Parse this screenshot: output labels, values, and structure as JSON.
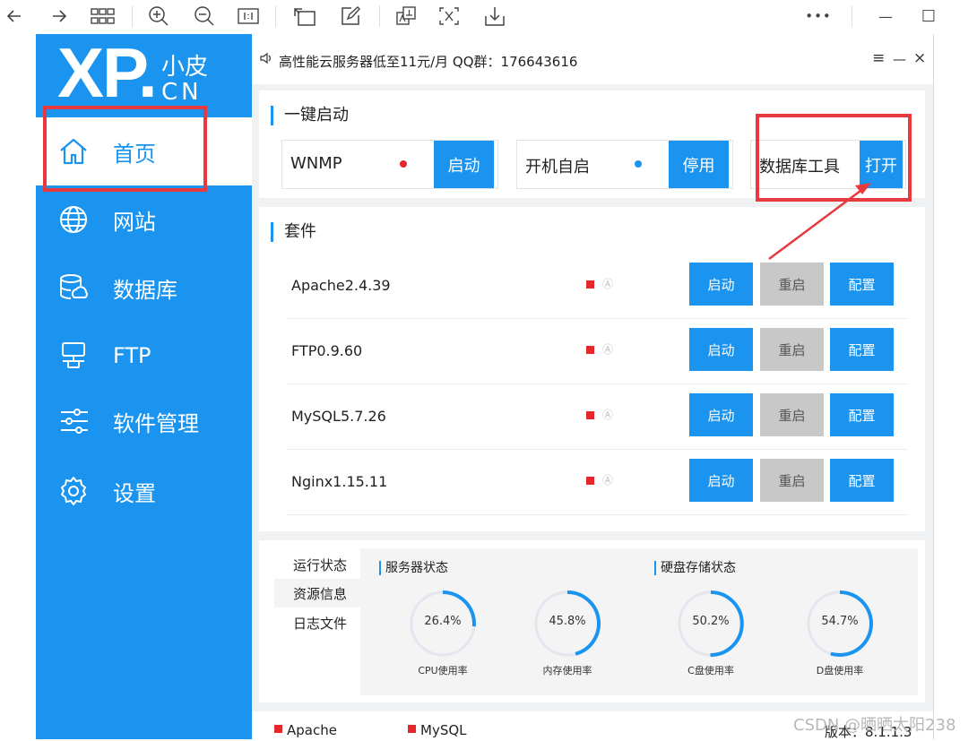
{
  "toolbar": {
    "icons": [
      "back-arrow-icon",
      "forward-arrow-icon",
      "grid-icon",
      "zoom-in-icon",
      "zoom-out-icon",
      "actual-size-icon",
      "rotate-icon",
      "edit-icon",
      "translate-icon",
      "ocr-icon",
      "download-icon",
      "more-icon",
      "minimize-icon",
      "maximize-icon"
    ],
    "more": "•••",
    "minimize": "—",
    "maximize": "☐"
  },
  "sidebar": {
    "logo_main": "XP.",
    "logo_cn1": "小皮",
    "logo_cn2": "CN",
    "items": [
      {
        "label": "首页",
        "icon": "home-icon",
        "active": true
      },
      {
        "label": "网站",
        "icon": "globe-icon",
        "active": false
      },
      {
        "label": "数据库",
        "icon": "database-icon",
        "active": false
      },
      {
        "label": "FTP",
        "icon": "ftp-icon",
        "active": false
      },
      {
        "label": "软件管理",
        "icon": "sliders-icon",
        "active": false
      },
      {
        "label": "设置",
        "icon": "gear-icon",
        "active": false
      }
    ]
  },
  "notice": {
    "text": "高性能云服务器低至11元/月  QQ群：176643616",
    "menu": "≡",
    "min": "—",
    "close": "×"
  },
  "quick": {
    "title": "一键启动",
    "items": [
      {
        "label": "WNMP",
        "dot_color": "#e5262a",
        "button": "启动"
      },
      {
        "label": "开机自启",
        "dot_color": "#1a94ef",
        "button": "停用"
      },
      {
        "label": "数据库工具",
        "button": "打开"
      }
    ]
  },
  "suite": {
    "title": "套件",
    "auto_glyph": "Ⓐ",
    "rows": [
      {
        "name": "Apache2.4.39",
        "start": "启动",
        "restart": "重启",
        "config": "配置"
      },
      {
        "name": "FTP0.9.60",
        "start": "启动",
        "restart": "重启",
        "config": "配置"
      },
      {
        "name": "MySQL5.7.26",
        "start": "启动",
        "restart": "重启",
        "config": "配置"
      },
      {
        "name": "Nginx1.15.11",
        "start": "启动",
        "restart": "重启",
        "config": "配置"
      }
    ]
  },
  "status": {
    "tabs": [
      {
        "label": "运行状态",
        "selected": false
      },
      {
        "label": "资源信息",
        "selected": true
      },
      {
        "label": "日志文件",
        "selected": false
      }
    ],
    "server_title": "服务器状态",
    "disk_title": "硬盘存储状态",
    "gauges": [
      {
        "value": "26.4%",
        "percent": 26.4,
        "label": "CPU使用率"
      },
      {
        "value": "45.8%",
        "percent": 45.8,
        "label": "内存使用率"
      },
      {
        "value": "50.2%",
        "percent": 50.2,
        "label": "C盘使用率"
      },
      {
        "value": "54.7%",
        "percent": 54.7,
        "label": "D盘使用率"
      }
    ]
  },
  "footer": {
    "items": [
      "Apache",
      "MySQL"
    ],
    "version": "版本：8.1.1.3"
  },
  "watermark": "CSDN @晒晒太阳238",
  "colors": {
    "accent": "#1a94ef",
    "stopped": "#e5262a",
    "annotation": "#e83a3e"
  }
}
